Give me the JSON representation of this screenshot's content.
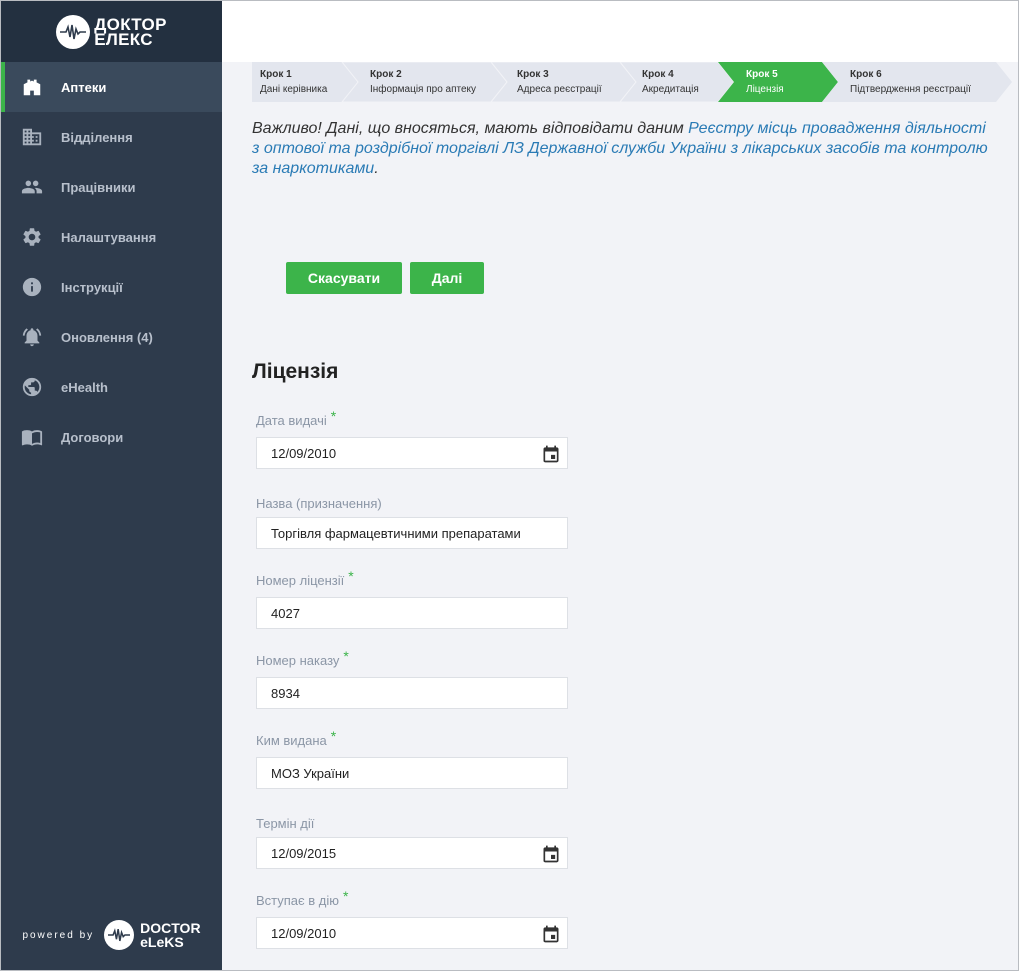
{
  "brand": {
    "logo_line1": "ДОКТОР",
    "logo_line2": "ЕЛЕКС",
    "powered_by": "powered by",
    "powered_line1": "DOCTOR",
    "powered_line2": "eLeKS"
  },
  "sidebar": {
    "items": [
      {
        "label": "Аптеки",
        "icon": "pharmacy-icon",
        "active": true
      },
      {
        "label": "Відділення",
        "icon": "building-icon"
      },
      {
        "label": "Працівники",
        "icon": "people-icon"
      },
      {
        "label": "Налаштування",
        "icon": "gear-icon"
      },
      {
        "label": "Інструкції",
        "icon": "info-icon"
      },
      {
        "label": "Оновлення (4)",
        "icon": "bell-icon"
      },
      {
        "label": "eHealth",
        "icon": "globe-icon"
      },
      {
        "label": "Договори",
        "icon": "book-icon"
      }
    ]
  },
  "steps": [
    {
      "title": "Крок 1",
      "name": "Дані керівника"
    },
    {
      "title": "Крок 2",
      "name": "Інформація про аптеку"
    },
    {
      "title": "Крок 3",
      "name": "Адреса реєстрації"
    },
    {
      "title": "Крок 4",
      "name": "Акредитація"
    },
    {
      "title": "Крок 5",
      "name": "Ліцензія",
      "active": true
    },
    {
      "title": "Крок 6",
      "name": "Підтвердження реєстрації"
    }
  ],
  "notice": {
    "prefix": "Важливо! Дані, що вносяться, мають відповідати даним ",
    "link": "Реєстру місць провадження діяльності з оптової та роздрібної торгівлі ЛЗ Державної служби України з лікарських засобів та контролю за наркотиками",
    "suffix": "."
  },
  "buttons": {
    "cancel": "Скасувати",
    "next": "Далі"
  },
  "section_title": "Ліцензія",
  "fields": [
    {
      "label": "Дата видачі",
      "required": true,
      "value": "12/09/2010",
      "type": "date"
    },
    {
      "label": "Назва (призначення)",
      "required": false,
      "value": "Торгівля фармацевтичними препаратами",
      "type": "text"
    },
    {
      "label": "Номер ліцензії",
      "required": true,
      "value": "4027",
      "type": "text"
    },
    {
      "label": "Номер наказу",
      "required": true,
      "value": "8934",
      "type": "text"
    },
    {
      "label": "Ким видана",
      "required": true,
      "value": "МОЗ України",
      "type": "text"
    },
    {
      "label": "Термін дії",
      "required": false,
      "value": "12/09/2015",
      "type": "date"
    },
    {
      "label": "Вступає в дію",
      "required": true,
      "value": "12/09/2010",
      "type": "date"
    }
  ],
  "required_marker": "*",
  "colors": {
    "accent": "#3cb44a",
    "sidebar": "#2e3b4c",
    "link": "#2a7bb5",
    "step_inactive": "#e3e6ee"
  }
}
